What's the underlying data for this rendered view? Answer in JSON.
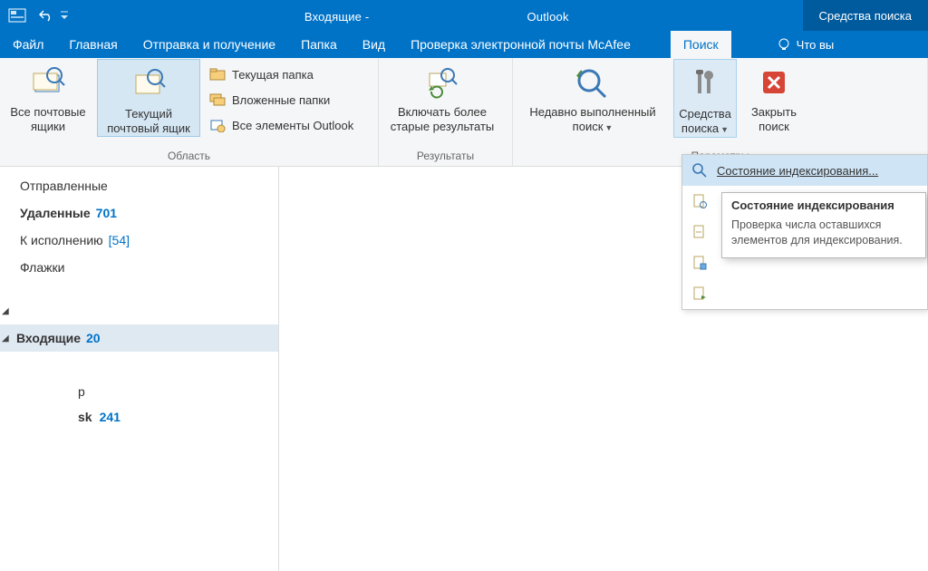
{
  "titlebar": {
    "prefix": "Входящие -",
    "suffix": "Outlook",
    "tool_tab": "Средства поиска"
  },
  "tabs": {
    "file": "Файл",
    "home": "Главная",
    "sendreceive": "Отправка и получение",
    "folder": "Папка",
    "view": "Вид",
    "mcafee": "Проверка электронной почты McAfee",
    "search": "Поиск",
    "tellme": "Что вы"
  },
  "ribbon": {
    "scope": {
      "all": "Все почтовые\nящики",
      "current": "Текущий\nпочтовый ящик",
      "curr_folder": "Текущая папка",
      "subfolders": "Вложенные папки",
      "all_outlook": "Все элементы Outlook",
      "label": "Область"
    },
    "refine": {
      "older": "Включать более\nстарые результаты",
      "label": "Результаты"
    },
    "options": {
      "recent": "Недавно выполненный\nпоиск",
      "tools": "Средства\nпоиска",
      "close": "Закрыть\nпоиск",
      "label": "Параметры"
    }
  },
  "dropdown": {
    "indexing": "Состояние индексирования...",
    "item2": "",
    "item3": "",
    "item4": "",
    "item5": ""
  },
  "tooltip": {
    "title": "Состояние индексирования",
    "body": "Проверка числа оставшихся элементов для индексирования."
  },
  "nav": {
    "sent": "Отправленные",
    "deleted": "Удаленные",
    "deleted_count": "701",
    "followup": "К исполнению",
    "followup_count": "[54]",
    "flags": "Флажки",
    "inbox": "Входящие",
    "inbox_count": "20",
    "fragment1": "р",
    "fragment2": "sk",
    "fragment2_count": "241"
  }
}
